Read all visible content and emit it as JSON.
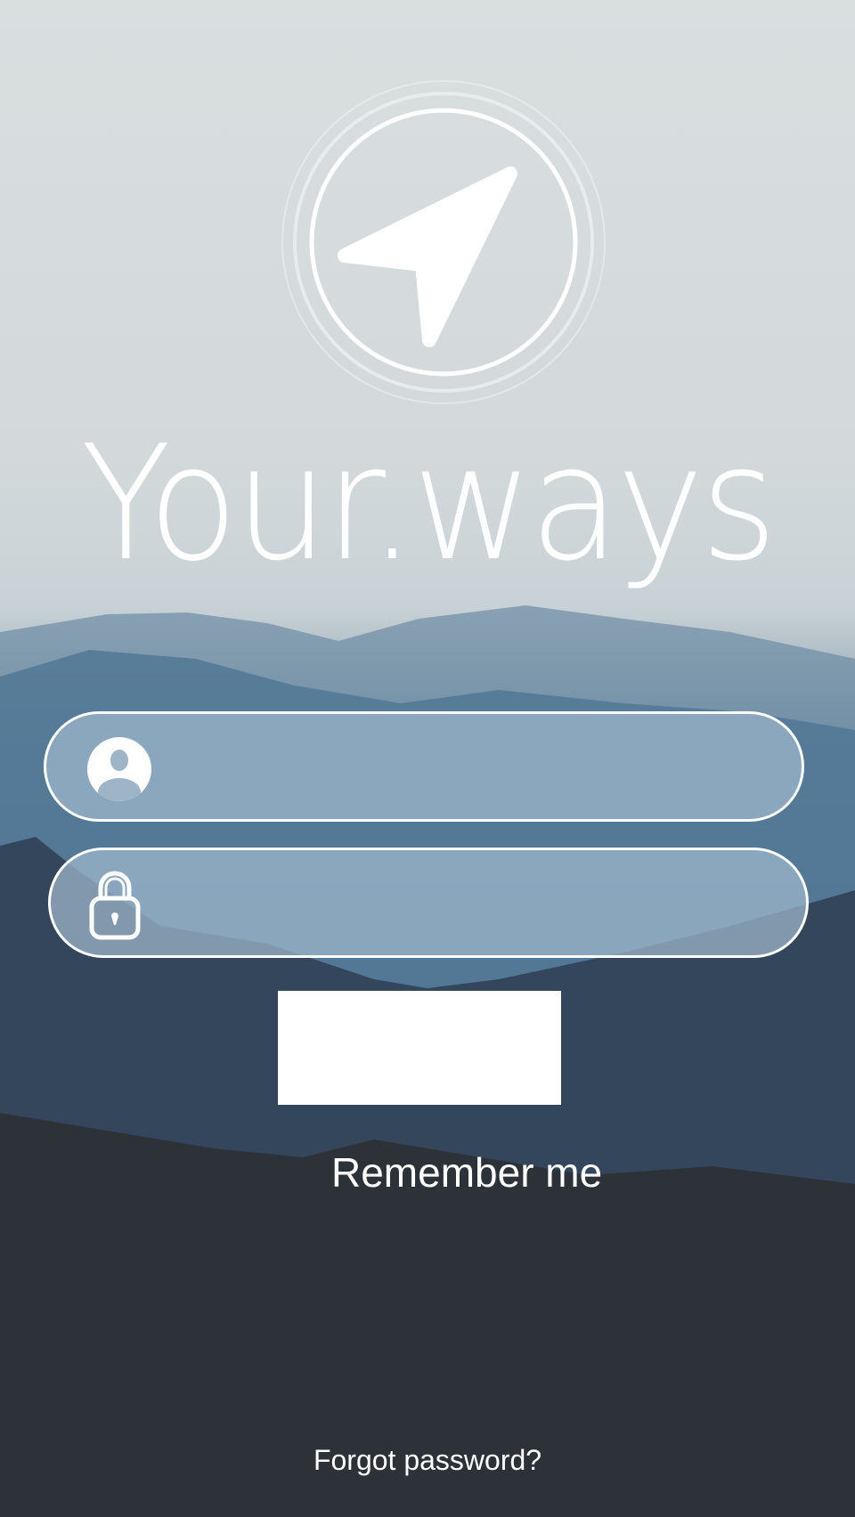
{
  "app": {
    "name": "Your.ways",
    "logo_icon": "navigation-arrow-icon"
  },
  "login": {
    "username": {
      "value": "",
      "placeholder": "",
      "icon": "user-icon"
    },
    "password": {
      "value": "",
      "placeholder": "",
      "icon": "lock-icon"
    },
    "submit_label": "",
    "remember_label": "Remember me",
    "forgot_label": "Forgot password?"
  },
  "colors": {
    "sky": "#d9dedf",
    "mountain": "#4c6f8c",
    "dark": "#2c3035",
    "accent": "#ffffff"
  }
}
